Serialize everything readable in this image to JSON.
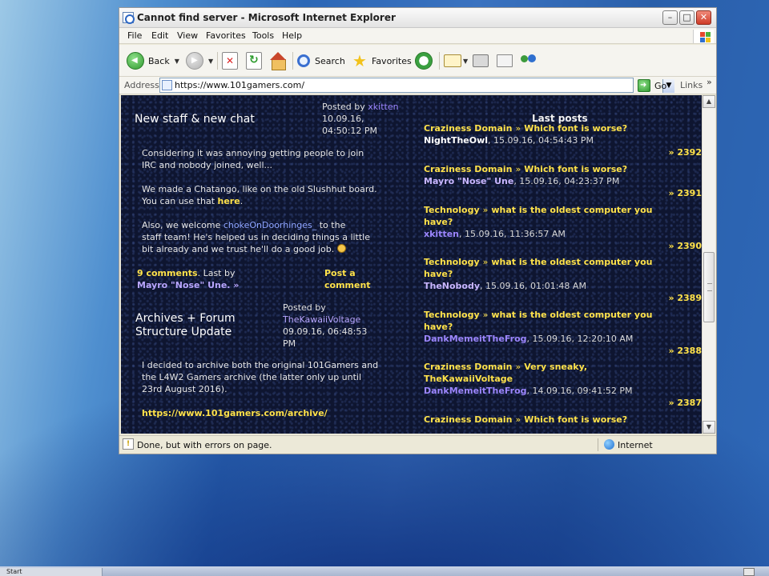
{
  "window": {
    "title": "Cannot find server - Microsoft Internet Explorer",
    "min_symbol": "–",
    "max_symbol": "□",
    "close_symbol": "✕"
  },
  "menu": [
    "File",
    "Edit",
    "View",
    "Favorites",
    "Tools",
    "Help"
  ],
  "toolbar": {
    "back": "Back",
    "search": "Search",
    "favorites": "Favorites"
  },
  "address": {
    "label": "Address",
    "url": "https://www.101gamers.com/",
    "go": "Go",
    "links": "Links",
    "links_more": "»"
  },
  "status": {
    "text": "Done, but with errors on page.",
    "zone": "Internet"
  },
  "taskbar": {
    "start_label": "Start"
  },
  "posts": [
    {
      "title": "New staff & new chat",
      "posted_by_label": "Posted by",
      "author": "xkitten",
      "date": "10.09.16,",
      "time": "04:50:12 PM",
      "p1_line1": "Considering it was annoying getting people to join",
      "p1_line2": "IRC and nobody joined, well...",
      "p2_line1": "We made a Chatango, like on the old Slushhut board.",
      "p2_line2_prefix": "You can use that ",
      "p2_link": "here",
      "p2_line2_suffix": ".",
      "p3_prefix": "Also, we welcome ",
      "p3_user": "chokeOnDoorhinges_",
      "p3_suffix": " to the",
      "p3_line2": "staff team! He's helped us in deciding things a little",
      "p3_line3": "bit already and we trust he'll do a good job.",
      "comments_link": "9 comments",
      "last_by_label": ". Last by",
      "last_by_user": "Mayro \"Nose\" Une.",
      "last_by_arrow": "»",
      "post_comment_line1": "Post a",
      "post_comment_line2": "comment"
    },
    {
      "title_line1": "Archives + Forum",
      "title_line2": "Structure Update",
      "posted_by_label": "Posted by",
      "author": "TheKawaiiVoltage",
      "date_time": "09.09.16, 06:48:53",
      "ampm": "PM",
      "p1_line1": "I decided to archive both the original 101Gamers and",
      "p1_line2": "the L4W2 Gamers archive (the latter only up until",
      "p1_line3": "23rd August 2016).",
      "archive_link": "https://www.101gamers.com/archive/"
    }
  ],
  "last_posts": {
    "header": "Last posts",
    "separator": "»",
    "items": [
      {
        "category": "Craziness Domain",
        "topic": "Which font is worse?",
        "user": "NightTheOwl",
        "user_color": "#ffffff",
        "date": ", 15.09.16, 04:54:43 PM",
        "num": "» 2392"
      },
      {
        "category": "Craziness Domain",
        "topic": "Which font is worse?",
        "user": "Mayro \"Nose\" Une",
        "user_color": "#c9b6ff",
        "date": ", 15.09.16, 04:23:37 PM",
        "num": "» 2391"
      },
      {
        "category": "Technology",
        "topic": "what is the oldest computer you",
        "topic2": "have?",
        "user": "xkitten",
        "user_color": "#9c86ff",
        "date": ", 15.09.16, 11:36:57 AM",
        "num": "» 2390"
      },
      {
        "category": "Technology",
        "topic": "what is the oldest computer you",
        "topic2": "have?",
        "user": "TheNobody",
        "user_color": "#c9b6ff",
        "date": ", 15.09.16, 01:01:48 AM",
        "num": "» 2389"
      },
      {
        "category": "Technology",
        "topic": "what is the oldest computer you",
        "topic2": "have?",
        "user": "DankMemeitTheFrog",
        "user_color": "#9c86ff",
        "date": ", 15.09.16, 12:20:10 AM",
        "num": "» 2388"
      },
      {
        "category": "Craziness Domain",
        "topic": "Very sneaky,",
        "topic2": "TheKawaiiVoltage",
        "user": "DankMemeitTheFrog",
        "user_color": "#9c86ff",
        "date": ", 14.09.16, 09:41:52 PM",
        "num": "» 2387"
      },
      {
        "category": "Craziness Domain",
        "topic": "Which font is worse?",
        "user": "",
        "user_color": "#ffffff",
        "date": "",
        "num": ""
      }
    ]
  }
}
